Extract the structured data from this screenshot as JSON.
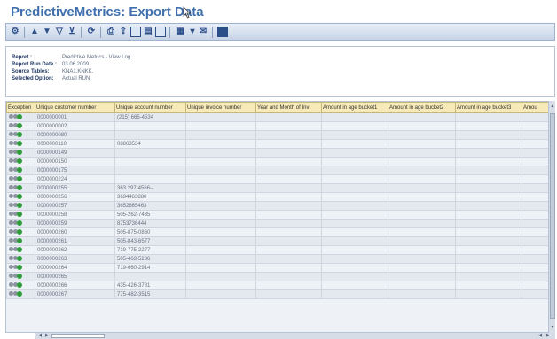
{
  "app": {
    "title": "PredictiveMetrics: Export Data"
  },
  "toolbar": {
    "icons": [
      "settings-icon",
      "details-icon",
      "sort-ascending-icon",
      "sort-descending-icon",
      "filter-icon",
      "refresh-icon",
      "print-icon",
      "export-icon",
      "spreadsheet-icon",
      "layout-icon",
      "chart-icon",
      "layout-dropdown-icon",
      "send-icon",
      "info-icon"
    ]
  },
  "report_header": {
    "rows": [
      {
        "key": "Report :",
        "value": "Predictive Metrics - View Log"
      },
      {
        "key": "Report Run Date :",
        "value": "03.06.2009"
      },
      {
        "key": "Source Tables:",
        "value": "KNA1,KNKK,"
      },
      {
        "key": "Selected Option:",
        "value": "Actual RUN"
      }
    ]
  },
  "grid": {
    "columns": [
      "Exception",
      "Unique customer number",
      "Unique account number",
      "Unique invoice number",
      "Year and Month of Inv",
      "Amount in age bucket1",
      "Amount in age bucket2",
      "Amount in age bucket3",
      "Amou"
    ],
    "rows": [
      {
        "exception": "green",
        "customer": "0000000001",
        "account": "(215) 665-4534"
      },
      {
        "exception": "green",
        "customer": "0000000002",
        "account": ""
      },
      {
        "exception": "green",
        "customer": "0000000080",
        "account": ""
      },
      {
        "exception": "green",
        "customer": "0000000110",
        "account": "08863534"
      },
      {
        "exception": "green",
        "customer": "0000000149",
        "account": ""
      },
      {
        "exception": "green",
        "customer": "0000000150",
        "account": ""
      },
      {
        "exception": "green",
        "customer": "0000000175",
        "account": ""
      },
      {
        "exception": "green",
        "customer": "0000000224",
        "account": ""
      },
      {
        "exception": "green",
        "customer": "0000000255",
        "account": "363 297-4566--"
      },
      {
        "exception": "green",
        "customer": "0000000256",
        "account": "3634463880"
      },
      {
        "exception": "green",
        "customer": "0000000257",
        "account": "3652865463"
      },
      {
        "exception": "green",
        "customer": "0000000258",
        "account": "505-262-7435"
      },
      {
        "exception": "green",
        "customer": "0000000259",
        "account": "8753736444"
      },
      {
        "exception": "green",
        "customer": "0000000260",
        "account": "505-875-0860"
      },
      {
        "exception": "green",
        "customer": "0000000261",
        "account": "505-843-6577"
      },
      {
        "exception": "green",
        "customer": "0000000262",
        "account": "719-775-2277"
      },
      {
        "exception": "green",
        "customer": "0000000263",
        "account": "505-463-5286"
      },
      {
        "exception": "green",
        "customer": "0000000264",
        "account": "719-660-2914"
      },
      {
        "exception": "green",
        "customer": "0000000265",
        "account": ""
      },
      {
        "exception": "green",
        "customer": "0000000266",
        "account": "435-426-3781"
      },
      {
        "exception": "green",
        "customer": "0000000267",
        "account": "775-482-3515"
      }
    ]
  },
  "colors": {
    "title": "#3f6fae",
    "header_fill": "#f7e9b8",
    "exception_red": "#c62828",
    "exception_yellow": "#d4a017",
    "exception_green": "#2e9e3a"
  }
}
